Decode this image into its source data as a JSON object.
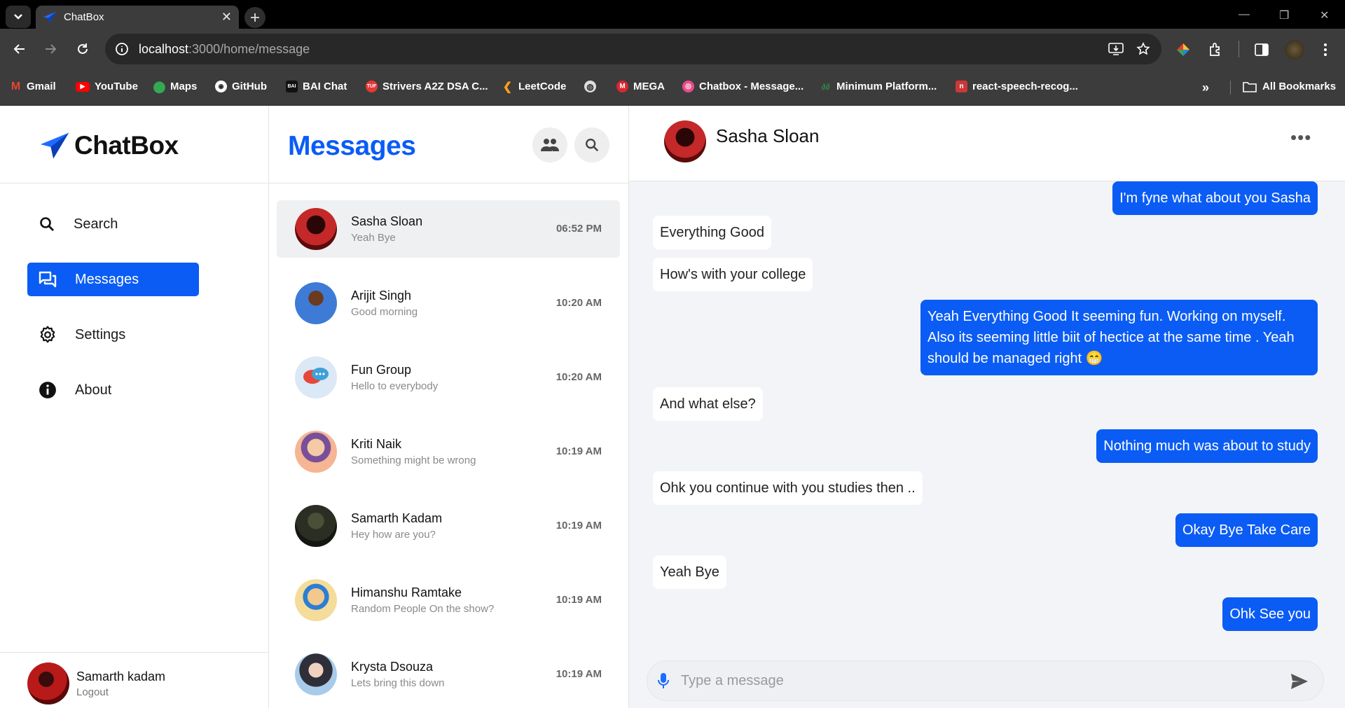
{
  "browser": {
    "tab_title": "ChatBox",
    "url_host": "localhost",
    "url_path": ":3000/home/message",
    "bookmarks": [
      {
        "label": "Gmail",
        "color": "#ea4335"
      },
      {
        "label": "YouTube",
        "color": "#ff0000"
      },
      {
        "label": "Maps",
        "color": "#34a853"
      },
      {
        "label": "GitHub",
        "color": "#ffffff"
      },
      {
        "label": "BAI Chat",
        "color": "#222222"
      },
      {
        "label": "Strivers A2Z DSA C...",
        "color": "#e53935"
      },
      {
        "label": "LeetCode",
        "color": "#ffa116"
      },
      {
        "label": "",
        "color": "#dddddd"
      },
      {
        "label": "MEGA",
        "color": "#d9272e"
      },
      {
        "label": "Chatbox - Message...",
        "color": "#ea4c89"
      },
      {
        "label": "Minimum Platform...",
        "color": "#2f8d46"
      },
      {
        "label": "react-speech-recog...",
        "color": "#cb3837"
      }
    ],
    "all_bookmarks": "All Bookmarks"
  },
  "sidebar": {
    "logo": "ChatBox",
    "items": [
      {
        "label": "Search",
        "icon": "search-icon"
      },
      {
        "label": "Messages",
        "icon": "messages-icon"
      },
      {
        "label": "Settings",
        "icon": "gear-icon"
      },
      {
        "label": "About",
        "icon": "info-icon"
      }
    ],
    "user": {
      "name": "Samarth kadam",
      "logout": "Logout"
    }
  },
  "conversations": {
    "title": "Messages",
    "items": [
      {
        "name": "Sasha Sloan",
        "last": "Yeah Bye",
        "time": "06:52 PM"
      },
      {
        "name": "Arijit Singh",
        "last": "Good morning",
        "time": "10:20 AM"
      },
      {
        "name": "Fun Group",
        "last": "Hello to everybody",
        "time": "10:20 AM"
      },
      {
        "name": "Kriti Naik",
        "last": "Something might be wrong",
        "time": "10:19 AM"
      },
      {
        "name": "Samarth Kadam",
        "last": "Hey how are you?",
        "time": "10:19 AM"
      },
      {
        "name": "Himanshu Ramtake",
        "last": "Random People On the show?",
        "time": "10:19 AM"
      },
      {
        "name": "Krysta Dsouza",
        "last": "Lets bring this down",
        "time": "10:19 AM"
      }
    ]
  },
  "chat": {
    "name": "Sasha Sloan",
    "more": "•••",
    "messages": [
      {
        "from": "me",
        "text": "I'm fyne what about you Sasha"
      },
      {
        "from": "them",
        "text": "Everything Good"
      },
      {
        "from": "them",
        "text": "How's with your college"
      },
      {
        "from": "me",
        "text": "Yeah Everything Good It seeming fun. Working on myself. Also its seeming little biit of hectice at the same time . Yeah should be managed right 😁"
      },
      {
        "from": "them",
        "text": "And what else?"
      },
      {
        "from": "me",
        "text": "Nothing much was about to study"
      },
      {
        "from": "them",
        "text": "Ohk you continue with you studies then .."
      },
      {
        "from": "me",
        "text": "Okay Bye Take Care"
      },
      {
        "from": "them",
        "text": "Yeah Bye"
      },
      {
        "from": "me",
        "text": "Ohk See you"
      }
    ],
    "input_placeholder": "Type a message"
  },
  "colors": {
    "accent": "#0a5cf5",
    "chat_bg": "#f3f4f7"
  }
}
